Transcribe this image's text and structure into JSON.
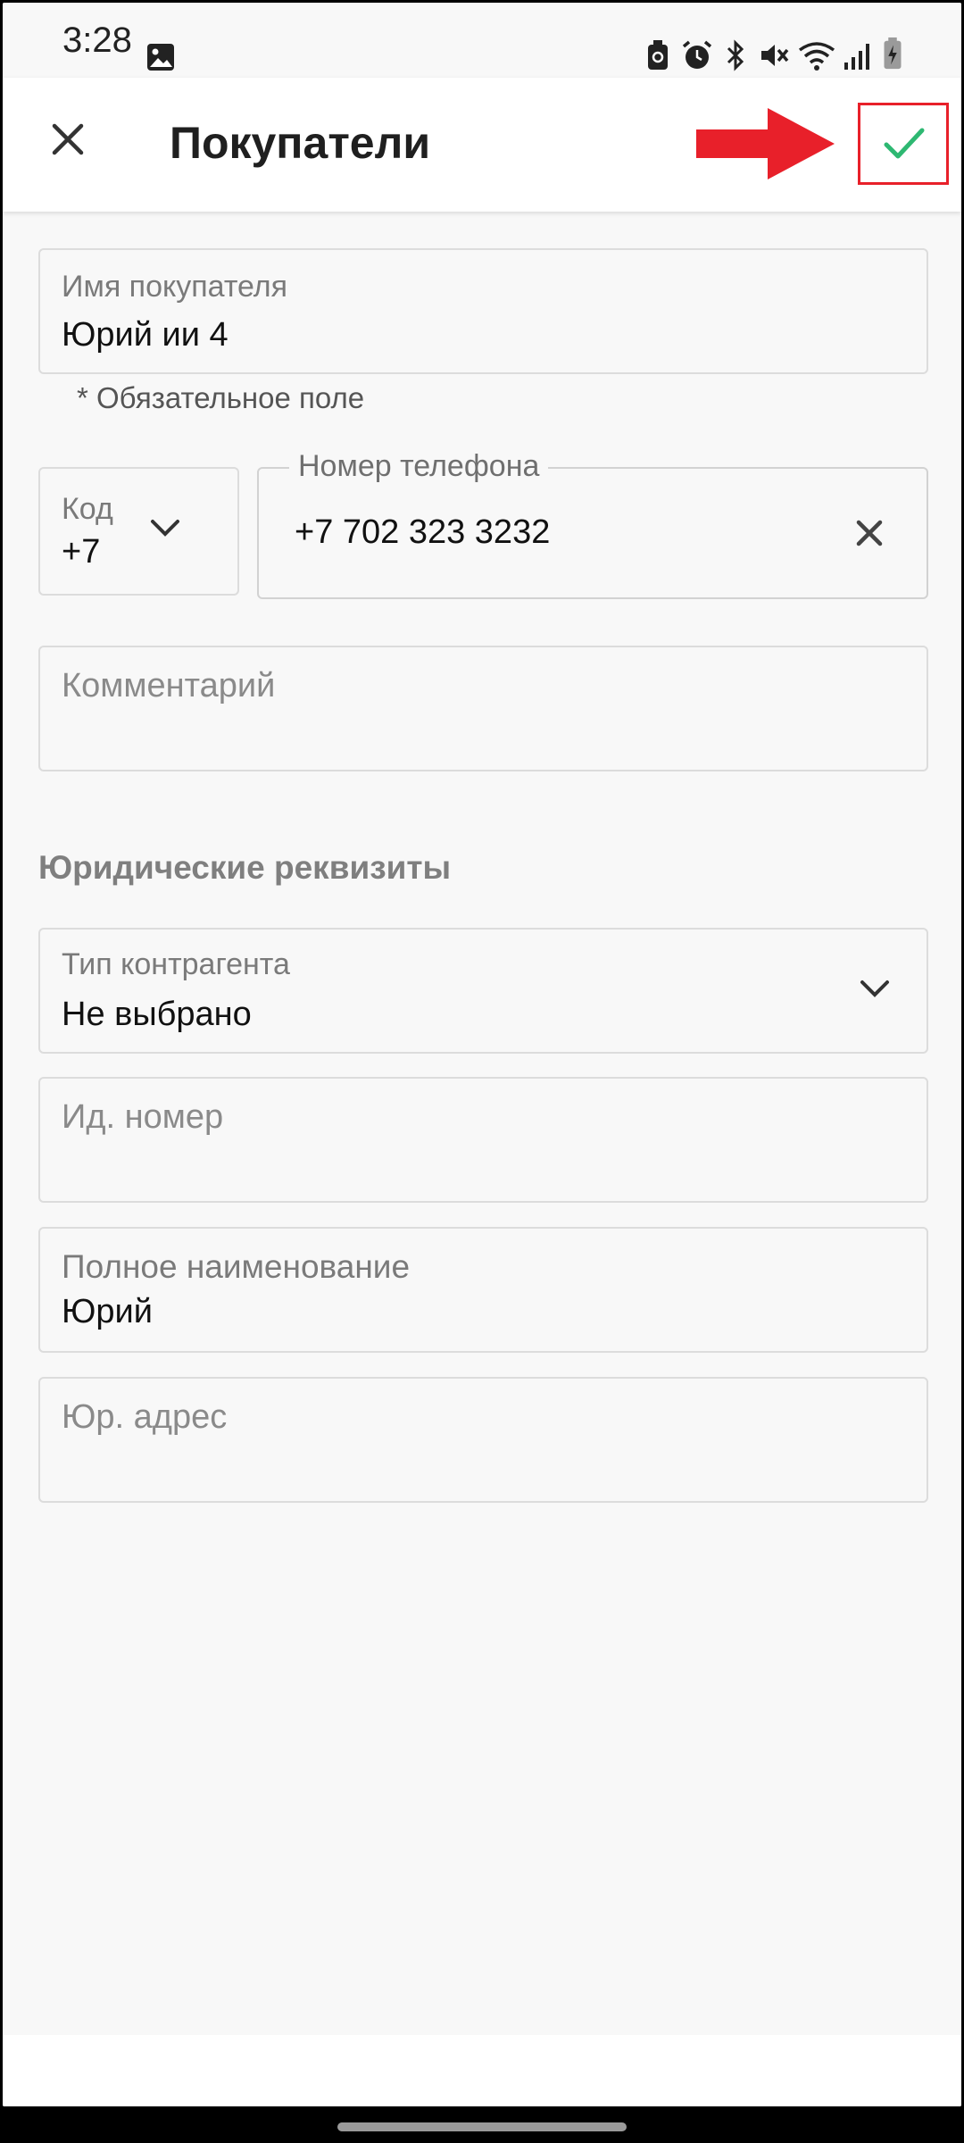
{
  "status_bar": {
    "time": "3:28",
    "icons": [
      "image-icon",
      "battery-saver-icon",
      "alarm-icon",
      "bluetooth-icon",
      "mute-icon",
      "wifi-icon",
      "signal-icon",
      "battery-charging-icon"
    ]
  },
  "app_bar": {
    "title": "Покупатели",
    "close_icon": "close-icon",
    "confirm_icon": "check-icon",
    "accent_color": "#2eb872",
    "highlight_color": "#e8202a"
  },
  "form": {
    "name": {
      "label": "Имя покупателя",
      "value": "Юрий ии 4",
      "helper": "* Обязательное поле"
    },
    "code": {
      "label": "Код",
      "value": "+7"
    },
    "phone": {
      "label": "Номер телефона",
      "value": "+7 702 323 3232"
    },
    "comment": {
      "placeholder": "Комментарий"
    },
    "legal_section_title": "Юридические реквизиты",
    "counterparty_type": {
      "label": "Тип контрагента",
      "value": "Не выбрано"
    },
    "id_number": {
      "placeholder": "Ид. номер"
    },
    "full_name": {
      "label": "Полное наименование",
      "value": "Юрий"
    },
    "legal_address": {
      "placeholder": "Юр. адрес"
    }
  }
}
